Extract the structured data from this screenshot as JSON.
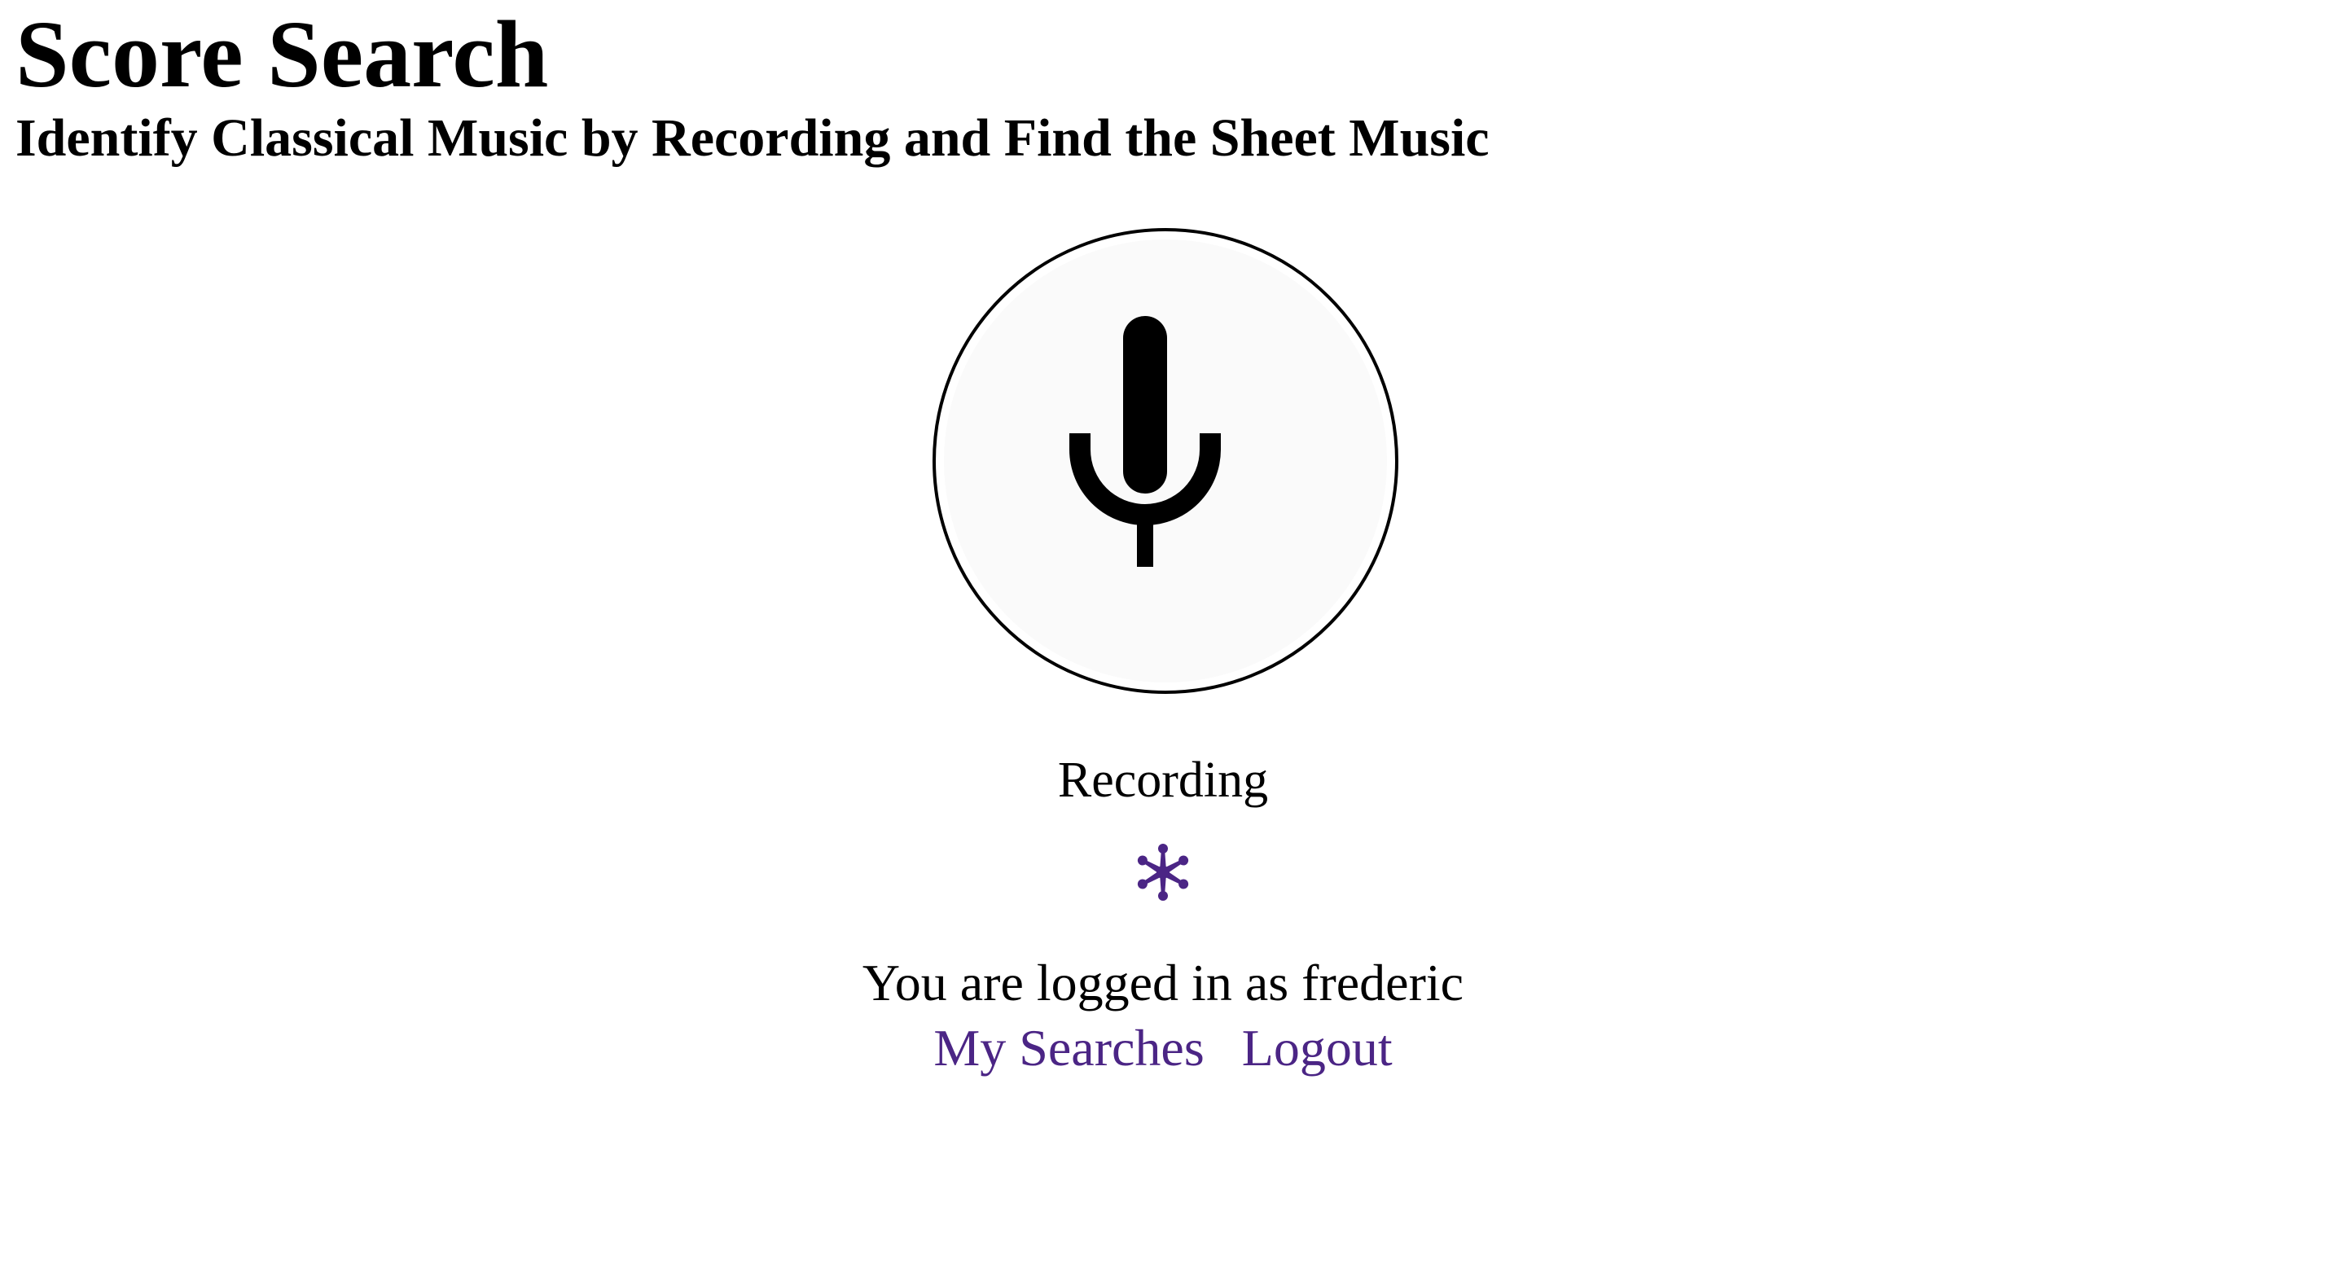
{
  "header": {
    "title": "Score Search",
    "subtitle": "Identify Classical Music by Recording and Find the Sheet Music"
  },
  "recorder": {
    "icon": "microphone-icon",
    "status_label": "Recording",
    "spinner_icon": "asterisk-spinner-icon",
    "accent_color": "#4b2585"
  },
  "account": {
    "login_text": "You are logged in as frederic",
    "links": {
      "my_searches": "My Searches",
      "logout": "Logout"
    }
  }
}
